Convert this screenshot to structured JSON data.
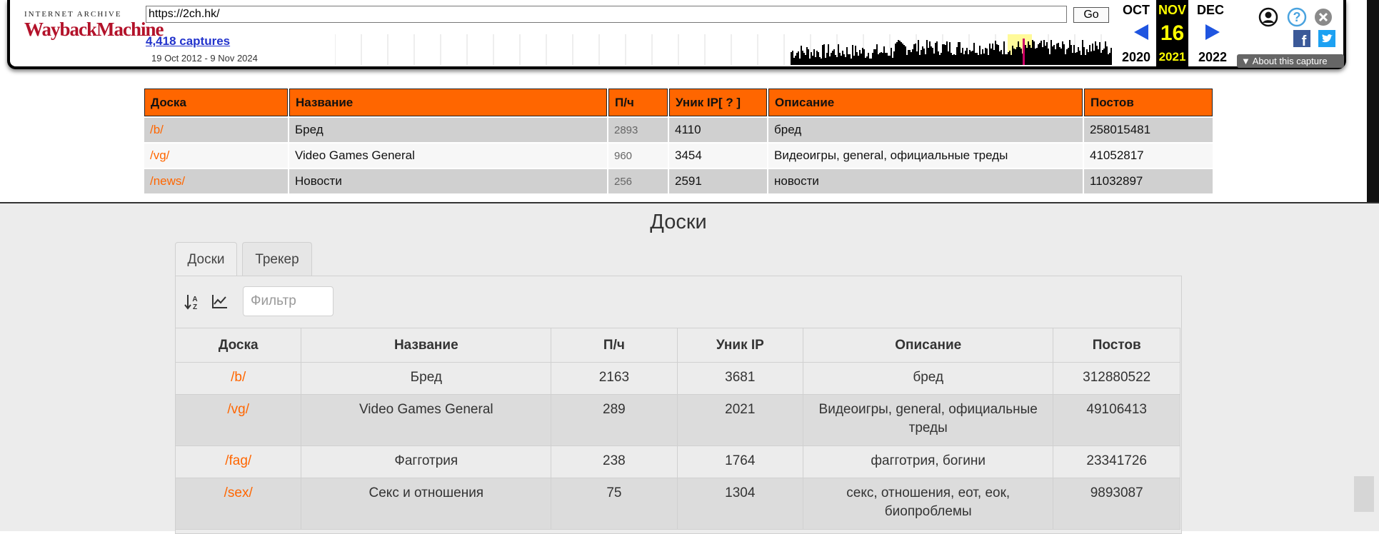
{
  "wayback": {
    "logo_top": "INTERNET ARCHIVE",
    "logo_main": "WaybackMachine",
    "url": "https://2ch.hk/",
    "go_label": "Go",
    "captures": "4,418 captures",
    "range": "19 Oct 2012 - 9 Nov 2024",
    "prev_month": "OCT",
    "cur_month": "NOV",
    "next_month": "DEC",
    "day": "16",
    "prev_year": "2020",
    "cur_year": "2021",
    "next_year": "2022",
    "about": "About this capture",
    "colors": {
      "accent": "#b3122a",
      "current": "#ffff00",
      "link": "#2233cc"
    },
    "icons": [
      "user-icon",
      "help-icon",
      "close-icon",
      "facebook-icon",
      "twitter-icon"
    ]
  },
  "old_page": {
    "headers": [
      "Доска",
      "Название",
      "П/ч",
      "Уник IP[ ? ]",
      "Описание",
      "Постов"
    ],
    "rows": [
      {
        "board": "/b/",
        "name": "Бред",
        "pph": "2893",
        "ip": "4110",
        "desc": "бред",
        "posts": "258015481"
      },
      {
        "board": "/vg/",
        "name": "Video Games General",
        "pph": "960",
        "ip": "3454",
        "desc": "Видеоигры, general, официальные треды",
        "posts": "41052817"
      },
      {
        "board": "/news/",
        "name": "Новости",
        "pph": "256",
        "ip": "2591",
        "desc": "новости",
        "posts": "11032897"
      }
    ]
  },
  "panel": {
    "title": "Доски",
    "tabs": [
      "Доски",
      "Трекер"
    ],
    "filter_placeholder": "Фильтр",
    "headers": [
      "Доска",
      "Название",
      "П/ч",
      "Уник IP",
      "Описание",
      "Постов"
    ],
    "rows": [
      {
        "board": "/b/",
        "name": "Бред",
        "pph": "2163",
        "ip": "3681",
        "desc": "бред",
        "posts": "312880522"
      },
      {
        "board": "/vg/",
        "name": "Video Games General",
        "pph": "289",
        "ip": "2021",
        "desc": "Видеоигры, general, официальные треды",
        "posts": "49106413"
      },
      {
        "board": "/fag/",
        "name": "Фагготрия",
        "pph": "238",
        "ip": "1764",
        "desc": "фагготрия, богини",
        "posts": "23341726"
      },
      {
        "board": "/sex/",
        "name": "Секс и отношения",
        "pph": "75",
        "ip": "1304",
        "desc": "секс, отношения, еот, еок, биопроблемы",
        "posts": "9893087"
      }
    ]
  }
}
